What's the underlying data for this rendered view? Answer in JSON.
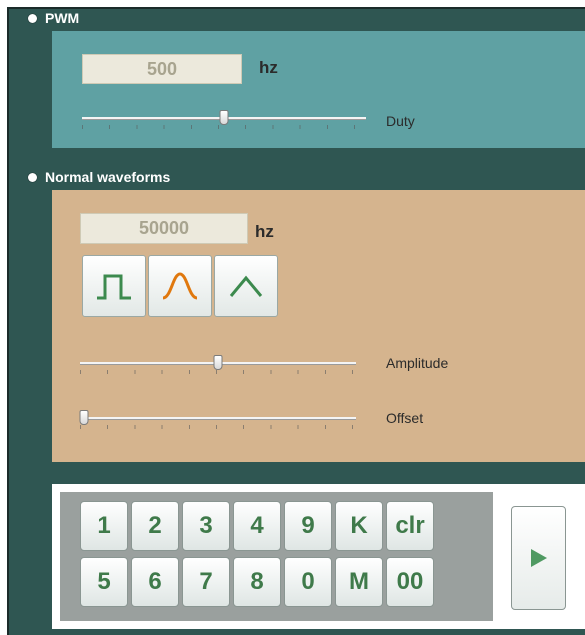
{
  "pwm": {
    "title": "PWM",
    "frequency_value": "500",
    "unit": "hz",
    "duty_label": "Duty",
    "duty_level": 0.5
  },
  "normal": {
    "title": "Normal waveforms",
    "frequency_value": "50000",
    "unit": "hz",
    "waveforms": [
      "square-wave-icon",
      "sine-wave-icon",
      "triangle-wave-icon"
    ],
    "amplitude_label": "Amplitude",
    "amplitude_level": 0.5,
    "offset_label": "Offset",
    "offset_level": 0.0
  },
  "keypad": {
    "rows": [
      [
        "1",
        "2",
        "3",
        "4",
        "9",
        "K",
        "clr"
      ],
      [
        "5",
        "6",
        "7",
        "8",
        "0",
        "M",
        "00"
      ]
    ],
    "send_icon": "play-icon"
  },
  "colors": {
    "frame": "#2f5652",
    "pwm_panel": "#5fa1a3",
    "wave_panel": "#d5b48e",
    "keypad_bg": "#9aa09e",
    "key_text": "#3f7a4a"
  }
}
